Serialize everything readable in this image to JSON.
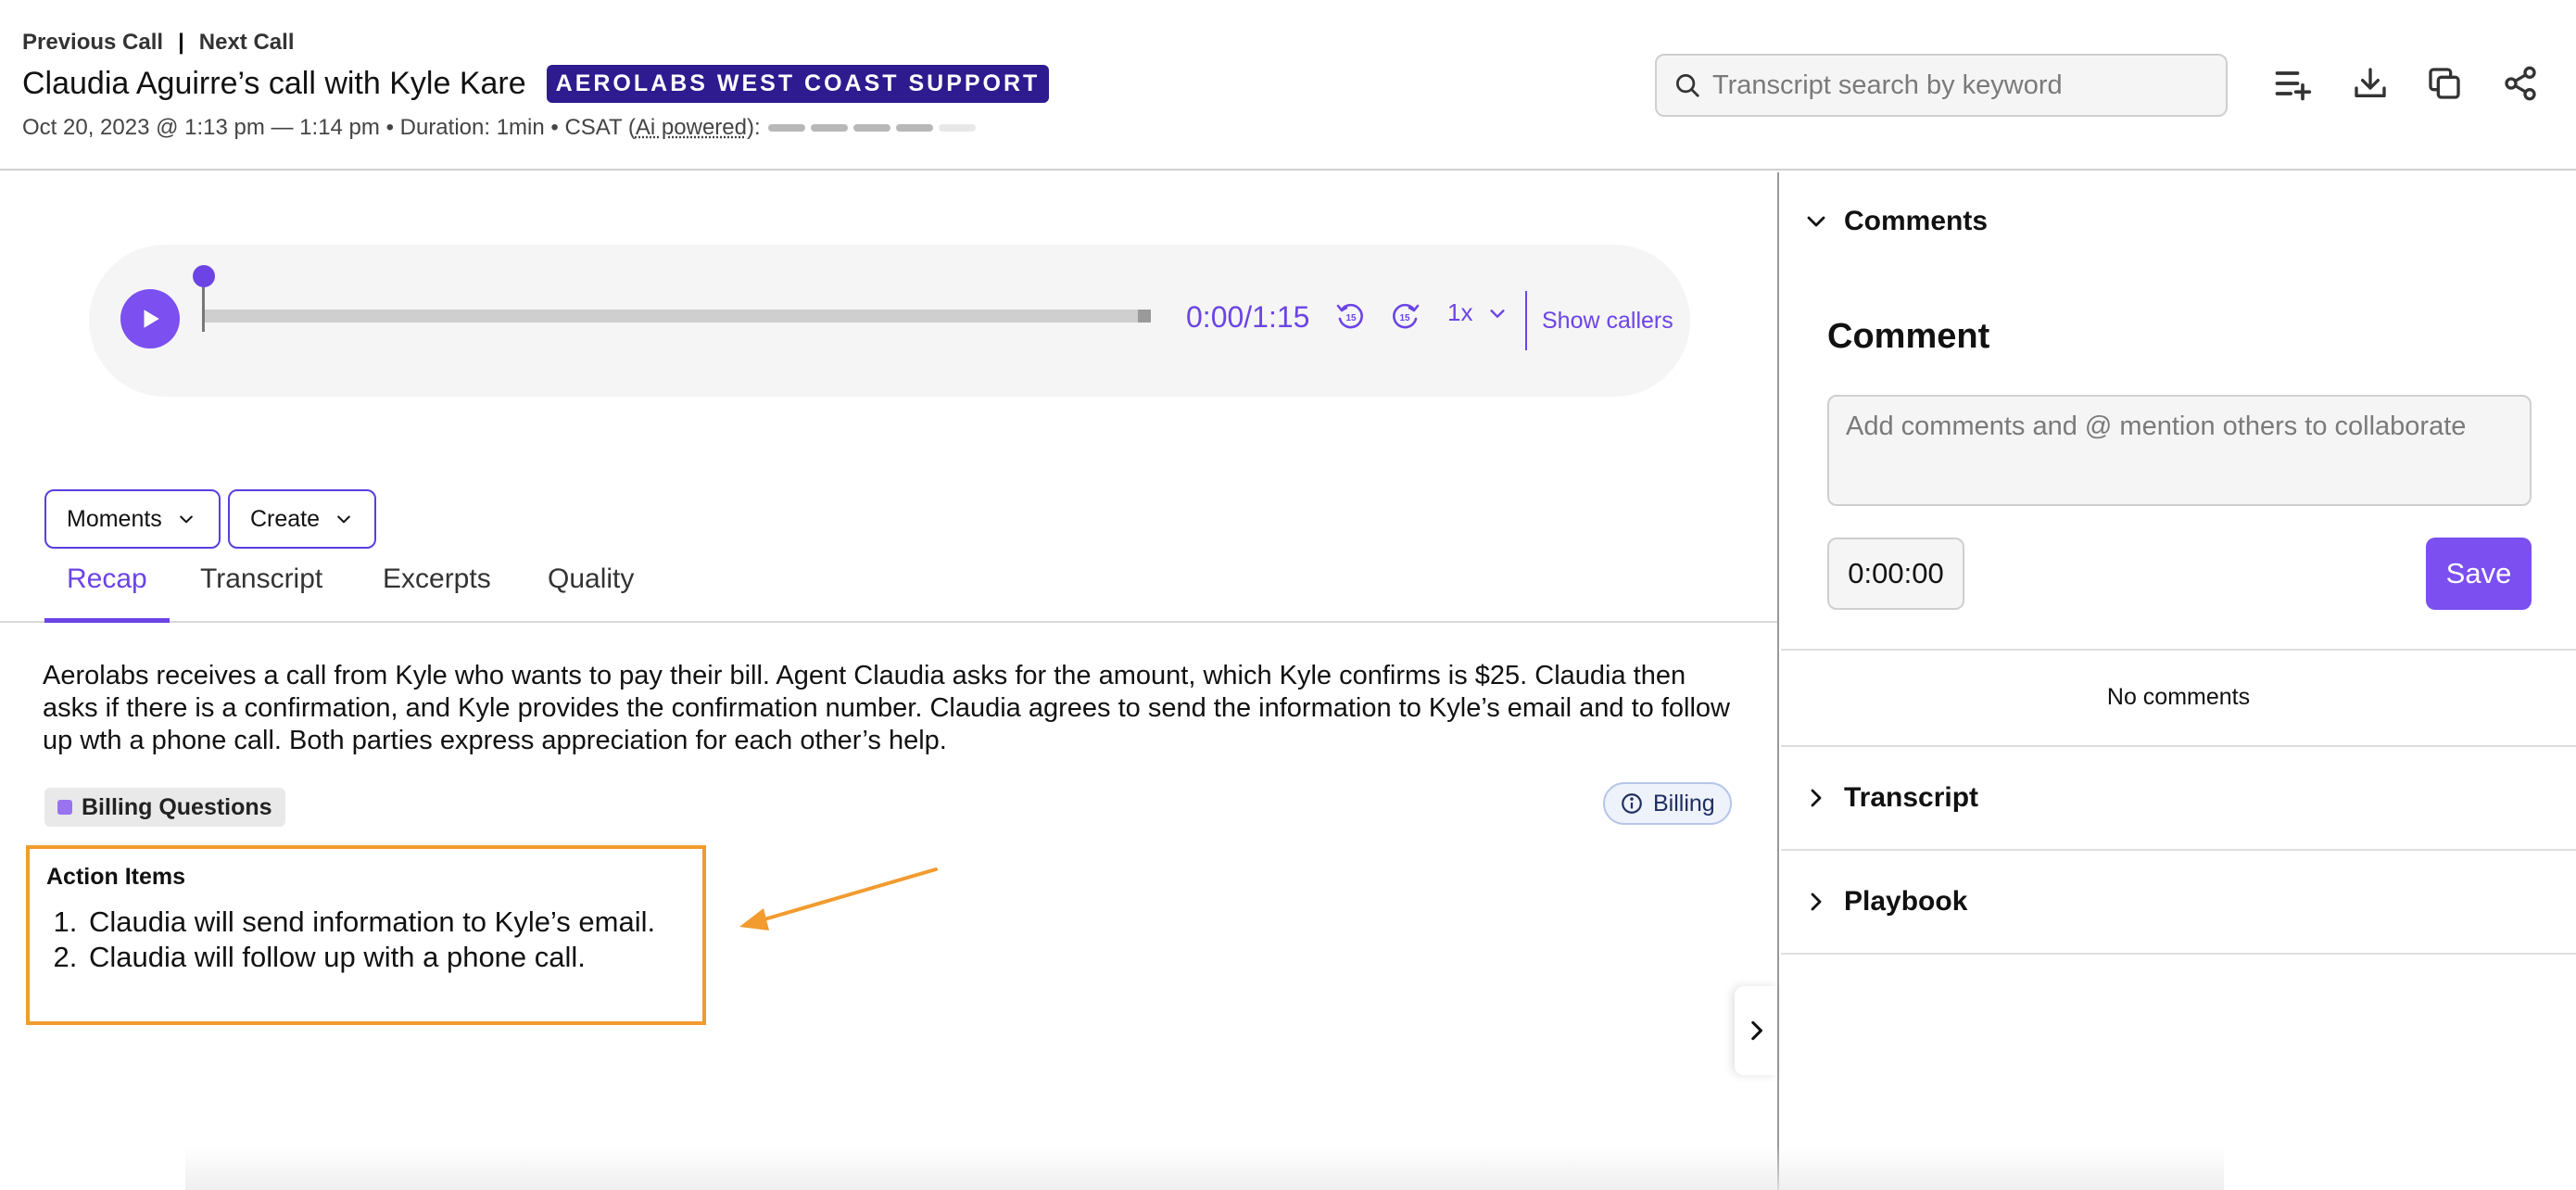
{
  "header": {
    "prev_call": "Previous Call",
    "separator": "|",
    "next_call": "Next Call",
    "title": "Claudia Aguirre’s call with Kyle Kare",
    "team_badge": "AEROLABS WEST COAST SUPPORT",
    "meta_prefix": "Oct 20, 2023 @ 1:13 pm — 1:14 pm • Duration: 1min • CSAT (",
    "meta_ai": "Ai powered",
    "meta_suffix": "):",
    "csat": {
      "filled": 4,
      "total": 5
    },
    "search_placeholder": "Transcript search by keyword",
    "icons": [
      "add-to-list-icon",
      "download-icon",
      "copy-icon",
      "share-icon"
    ]
  },
  "player": {
    "time": "0:00/1:15",
    "progress": 0,
    "speed": "1x",
    "show_callers": "Show callers",
    "skip_back_label": "15",
    "skip_forward_label": "15"
  },
  "controls": {
    "moments": "Moments",
    "create": "Create"
  },
  "tabs": [
    {
      "label": "Recap",
      "active": true
    },
    {
      "label": "Transcript",
      "active": false
    },
    {
      "label": "Excerpts",
      "active": false
    },
    {
      "label": "Quality",
      "active": false
    }
  ],
  "recap": {
    "summary": "Aerolabs receives a call from Kyle who wants to pay their bill. Agent Claudia asks for the amount, which Kyle confirms is $25. Claudia then asks if there is a confirmation, and Kyle provides the confirmation number. Claudia agrees to send the information to Kyle’s email and to follow up wth a phone call. Both parties express appreciation for each other’s help.",
    "topic": "Billing Questions",
    "category": "Billing",
    "action_items_title": "Action Items",
    "action_items": [
      "Claudia will send information to Kyle’s email.",
      "Claudia will follow up with a phone call."
    ]
  },
  "sidebar": {
    "comments_header": "Comments",
    "comment_title": "Comment",
    "comment_placeholder": "Add comments and @ mention others to collaborate",
    "timestamp_value": "0:00:00",
    "save": "Save",
    "no_comments": "No comments",
    "transcript_header": "Transcript",
    "playbook_header": "Playbook"
  },
  "colors": {
    "accent": "#7b4ff0",
    "badge": "#2d1b8f",
    "highlight_box": "#f29b2e"
  }
}
